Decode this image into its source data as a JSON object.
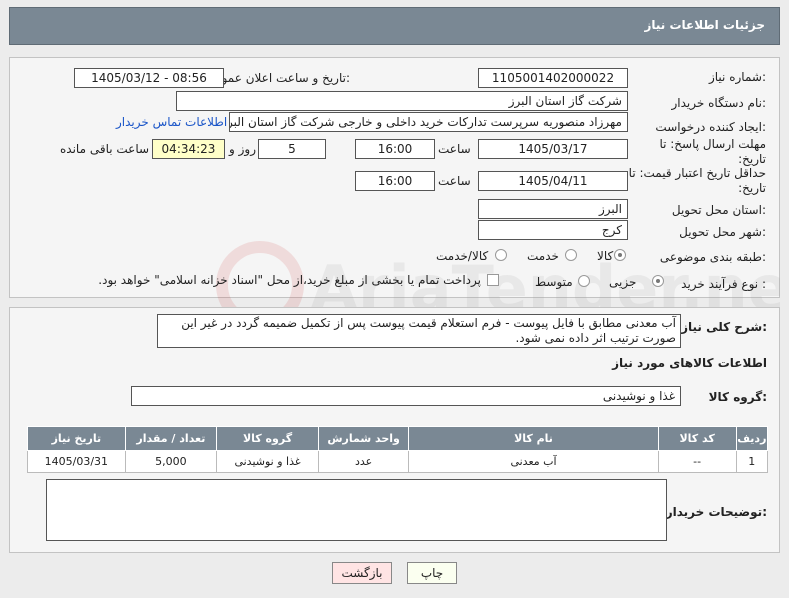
{
  "header": {
    "title": "جزئیات اطلاعات نیاز"
  },
  "form": {
    "need_number_label": "شماره نیاز:",
    "need_number": "1105001402000022",
    "announce_label": "تاریخ و ساعت اعلان عمومی:",
    "announce_value": "1405/03/12 - 08:56",
    "buyer_org_label": "نام دستگاه خریدار:",
    "buyer_org": "شرکت گاز استان البرز",
    "creator_label": "ایجاد کننده درخواست:",
    "creator": "مهرزاد منصوریه سرپرست تدارکات خرید داخلی و خارجی شرکت گاز استان البرز",
    "contact_link": "اطلاعات تماس خریدار",
    "reply_deadline_label": "مهلت ارسال پاسخ: تا تاریخ:",
    "reply_date": "1405/03/17",
    "time_label": "ساعت",
    "reply_time": "16:00",
    "days": "5",
    "days_label": "روز و",
    "remaining": "04:34:23",
    "remaining_label": "ساعت باقی مانده",
    "price_validity_label": "حداقل تاریخ اعتبار قیمت: تا تاریخ:",
    "validity_date": "1405/04/11",
    "validity_time": "16:00",
    "province_label": "استان محل تحویل:",
    "province": "البرز",
    "city_label": "شهر محل تحویل:",
    "city": "کرج",
    "category_label": "طبقه بندی موضوعی:",
    "category_options": [
      "کالا",
      "خدمت",
      "کالا/خدمت"
    ],
    "purchase_type_label": "نوع فرآیند خرید :",
    "purchase_options": [
      "جزیی",
      "متوسط"
    ],
    "payment_note": "پرداخت تمام یا بخشی از مبلغ خرید،از محل \"اسناد خزانه اسلامی\" خواهد بود."
  },
  "description": {
    "label": "شرح کلی نیاز:",
    "text": "آب معدنی مطابق با فایل پیوست - فرم استعلام قیمت پیوست پس از تکمیل ضمیمه گردد در غیر این صورت ترتیب اثر داده نمی شود."
  },
  "goods": {
    "section_title": "اطلاعات کالاهای مورد نیاز",
    "group_label": "گروه کالا:",
    "group_value": "غذا و نوشیدنی",
    "columns": [
      "ردیف",
      "کد کالا",
      "نام کالا",
      "واحد شمارش",
      "گروه کالا",
      "تعداد / مقدار",
      "تاریخ نیاز"
    ],
    "rows": [
      [
        "1",
        "--",
        "آب معدنی",
        "عدد",
        "غذا و نوشیدنی",
        "5,000",
        "1405/03/31"
      ]
    ]
  },
  "buyer_notes": {
    "label": "توضیحات خریدار:",
    "value": ""
  },
  "buttons": {
    "print": "چاپ",
    "back": "بازگشت"
  },
  "watermark": "AriaTender.net"
}
